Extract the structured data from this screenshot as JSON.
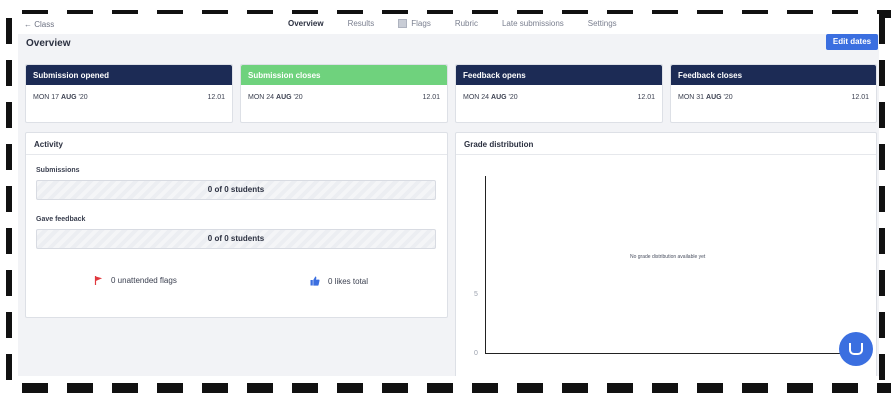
{
  "nav": {
    "back_label": "← Class",
    "tabs": [
      {
        "label": "Overview",
        "active": true
      },
      {
        "label": "Results"
      },
      {
        "label": "Flags"
      },
      {
        "label": "Rubric"
      },
      {
        "label": "Late submissions"
      },
      {
        "label": "Settings"
      }
    ]
  },
  "page": {
    "title": "Overview",
    "edit_dates_label": "Edit dates"
  },
  "dates": [
    {
      "title": "Submission opened",
      "day": "MON 17 ",
      "month": "AUG",
      "year": " '20",
      "time": "12.01"
    },
    {
      "title": "Submission closes",
      "day": "MON 24 ",
      "month": "AUG",
      "year": " '20",
      "time": "12.01",
      "color": "#6fd27d"
    },
    {
      "title": "Feedback opens",
      "day": "MON 24 ",
      "month": "AUG",
      "year": " '20",
      "time": "12.01"
    },
    {
      "title": "Feedback closes",
      "day": "MON 31 ",
      "month": "AUG",
      "year": " '20",
      "time": "12.01"
    }
  ],
  "activity": {
    "title": "Activity",
    "submissions_label": "Submissions",
    "submissions_value": "0 of 0 students",
    "feedback_label": "Gave feedback",
    "feedback_value": "0 of 0 students",
    "flags_text": "0 unattended flags",
    "likes_text": "0 likes total"
  },
  "grades": {
    "title": "Grade distribution",
    "empty_text": "No grade distribution available yet",
    "y_ticks": [
      "5",
      "0"
    ]
  },
  "colors": {
    "navy": "#1c2b55",
    "green": "#6fd27d",
    "accent": "#3b6fe0",
    "flag": "#e0393e"
  }
}
